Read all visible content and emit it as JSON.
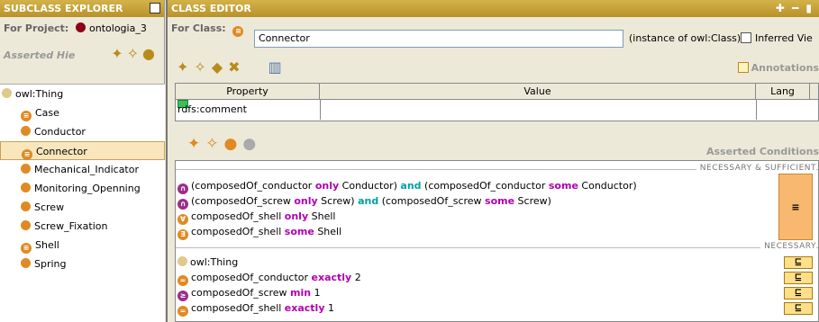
{
  "left_panel": {
    "title": "SUBCLASS EXPLORER",
    "for_project_label": "For Project:",
    "project_name": "ontologia_3",
    "asserted_label": "Asserted Hie",
    "tree": {
      "root": "owl:Thing",
      "children": [
        {
          "label": "Case",
          "icon": "equiv-class-icon"
        },
        {
          "label": "Conductor",
          "icon": "class-icon"
        },
        {
          "label": "Connector",
          "icon": "equiv-class-icon",
          "selected": true
        },
        {
          "label": "Mechanical_Indicator",
          "icon": "class-icon"
        },
        {
          "label": "Monitoring_Openning",
          "icon": "class-icon"
        },
        {
          "label": "Screw",
          "icon": "class-icon"
        },
        {
          "label": "Screw_Fixation",
          "icon": "class-icon"
        },
        {
          "label": "Shell",
          "icon": "equiv-class-icon"
        },
        {
          "label": "Spring",
          "icon": "class-icon"
        }
      ]
    }
  },
  "right_panel": {
    "title": "CLASS EDITOR",
    "for_class_label": "For Class:",
    "class_name": "Connector",
    "instance_of": "(instance of owl:Class)",
    "inferred_view": "Inferred Vie",
    "annotations_label": "Annotations",
    "table": {
      "headers": [
        "Property",
        "Value",
        "Lang"
      ],
      "rows": [
        {
          "property": "rdfs:comment",
          "value": "",
          "lang": ""
        }
      ]
    },
    "conditions_title": "Asserted Conditions",
    "sections": {
      "nec_suff": "NECESSARY & SUFFICIENT",
      "nec": "NECESSARY"
    },
    "conditions": {
      "c1": {
        "p1": "(composedOf_conductor ",
        "k1": "only",
        "p2": " Conductor) ",
        "k2": "and",
        "p3": " (composedOf_conductor ",
        "k3": "some",
        "p4": " Conductor)"
      },
      "c2": {
        "p1": "(composedOf_screw ",
        "k1": "only",
        "p2": " Screw) ",
        "k2": "and",
        "p3": " (composedOf_screw ",
        "k3": "some",
        "p4": " Screw)"
      },
      "c3": {
        "p1": "composedOf_shell ",
        "k1": "only",
        "p2": " Shell"
      },
      "c4": {
        "p1": "composedOf_shell ",
        "k1": "some",
        "p2": " Shell"
      },
      "n1": {
        "p1": "owl:Thing"
      },
      "n2": {
        "p1": "composedOf_conductor ",
        "k1": "exactly",
        "p2": " 2"
      },
      "n3": {
        "p1": "composedOf_screw ",
        "k1": "min",
        "p2": " 1"
      },
      "n4": {
        "p1": "composedOf_shell ",
        "k1": "exactly",
        "p2": " 1"
      }
    },
    "equiv_symbol": "≡",
    "sub_symbol": "⊑"
  },
  "colors": {
    "title_bar": "#c9a33a",
    "keyword_purple": "#b100b1",
    "keyword_teal": "#00a0a0",
    "selection": "#f9e6bd"
  }
}
